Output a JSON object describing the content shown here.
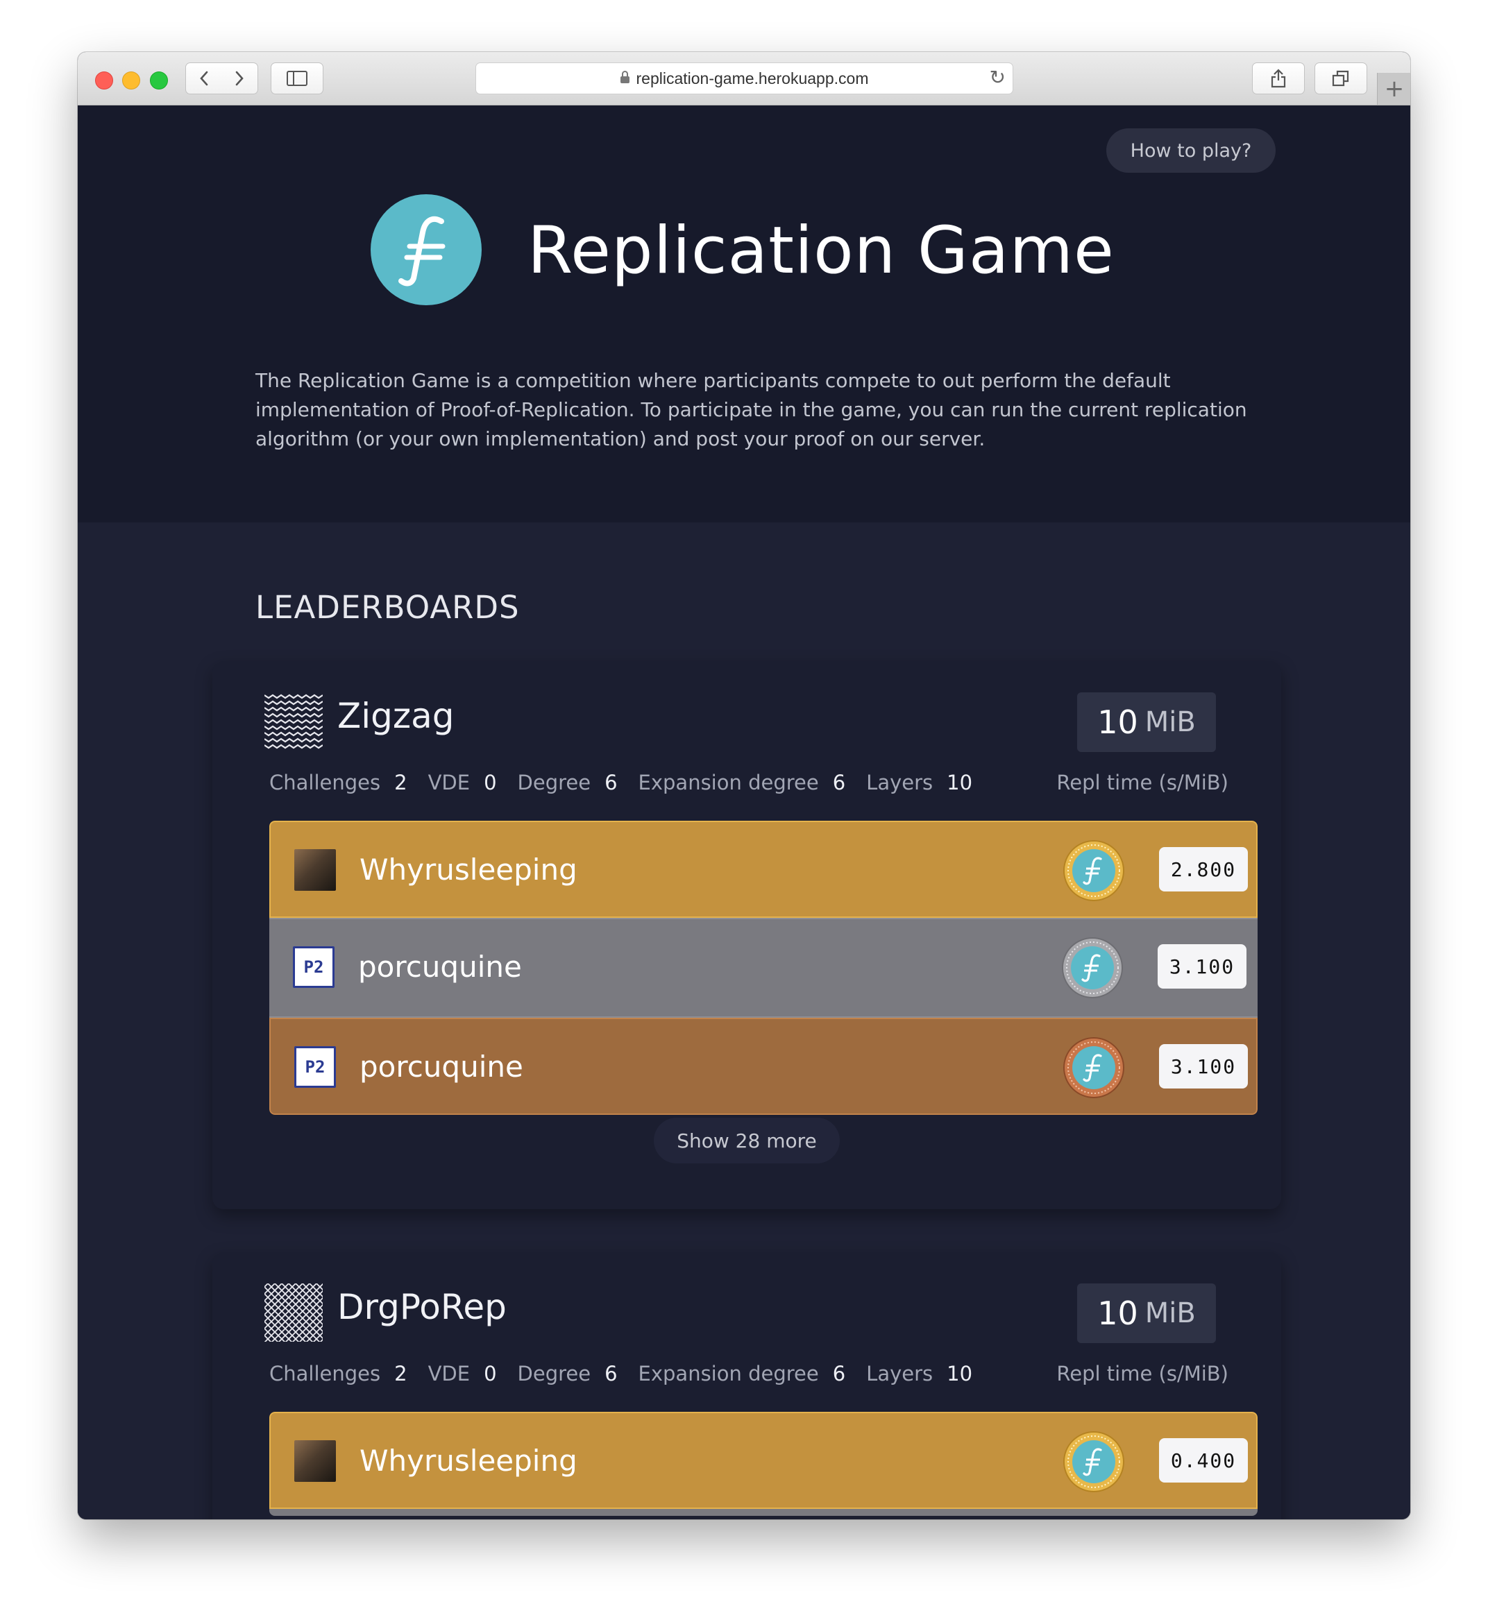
{
  "browser": {
    "url": "replication-game.herokuapp.com",
    "icons": [
      "back-icon",
      "forward-icon",
      "sidebar-icon",
      "lock-icon",
      "reload-icon",
      "share-icon",
      "tabs-icon",
      "plus-icon"
    ]
  },
  "hero": {
    "how_to_play": "How to play?",
    "title": "Replication Game",
    "logo_glyph": "⨍",
    "description": "The Replication Game is a competition where participants compete to out perform the default implementation of Proof-of-Replication. To participate in the game, you can run the current replication algorithm (or your own implementation) and post your proof on our server."
  },
  "leaderboards_heading": "LEADERBOARDS",
  "colors": {
    "gold": "#c4923e",
    "silver": "#7a7a80",
    "bronze": "#9e6b3e",
    "accent": "#5bbac9"
  },
  "boards": [
    {
      "name": "Zigzag",
      "size_value": "10",
      "size_unit": "MiB",
      "params": {
        "challenges_label": "Challenges",
        "challenges": "2",
        "vde_label": "VDE",
        "vde": "0",
        "degree_label": "Degree",
        "degree": "6",
        "expansion_label": "Expansion degree",
        "expansion": "6",
        "layers_label": "Layers",
        "layers": "10"
      },
      "repl_time_label": "Repl time (s/MiB)",
      "entries": [
        {
          "rank": "1.",
          "name": "Whyrusleeping",
          "time": "2.800",
          "medal": "gold"
        },
        {
          "rank": "2.",
          "name": "porcuquine",
          "time": "3.100",
          "medal": "silver"
        },
        {
          "rank": "3.",
          "name": "porcuquine",
          "time": "3.100",
          "medal": "bronze"
        }
      ],
      "show_more": "Show 28 more"
    },
    {
      "name": "DrgPoRep",
      "size_value": "10",
      "size_unit": "MiB",
      "params": {
        "challenges_label": "Challenges",
        "challenges": "2",
        "vde_label": "VDE",
        "vde": "0",
        "degree_label": "Degree",
        "degree": "6",
        "expansion_label": "Expansion degree",
        "expansion": "6",
        "layers_label": "Layers",
        "layers": "10"
      },
      "repl_time_label": "Repl time (s/MiB)",
      "entries": [
        {
          "rank": "1.",
          "name": "Whyrusleeping",
          "time": "0.400",
          "medal": "gold"
        }
      ]
    }
  ],
  "avatar_text": "P2"
}
